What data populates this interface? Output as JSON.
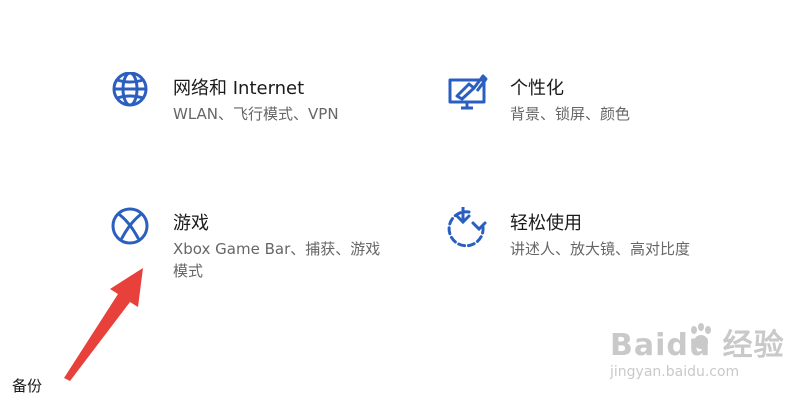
{
  "settings": {
    "tiles": [
      {
        "id": "network",
        "title": "网络和 Internet",
        "description": "WLAN、飞行模式、VPN",
        "icon": "globe-icon"
      },
      {
        "id": "personalization",
        "title": "个性化",
        "description": "背景、锁屏、颜色",
        "icon": "personalization-monitor-icon"
      },
      {
        "id": "gaming",
        "title": "游戏",
        "description": "Xbox Game Bar、捕获、游戏模式",
        "icon": "xbox-icon"
      },
      {
        "id": "ease_of_access",
        "title": "轻松使用",
        "description": "讲述人、放大镜、高对比度",
        "icon": "ease-of-access-icon"
      }
    ],
    "partial_item_label": "备份"
  },
  "annotation": {
    "type": "arrow",
    "color": "#e8403a",
    "points_to": "游戏"
  },
  "watermark": {
    "brand": "Baidu 经验",
    "url": "jingyan.baidu.com",
    "icon": "paw-logo"
  },
  "colors": {
    "accent": "#2b5fbf",
    "title_text": "#1a1a1a",
    "description_text": "#666666",
    "arrow": "#e8403a"
  }
}
